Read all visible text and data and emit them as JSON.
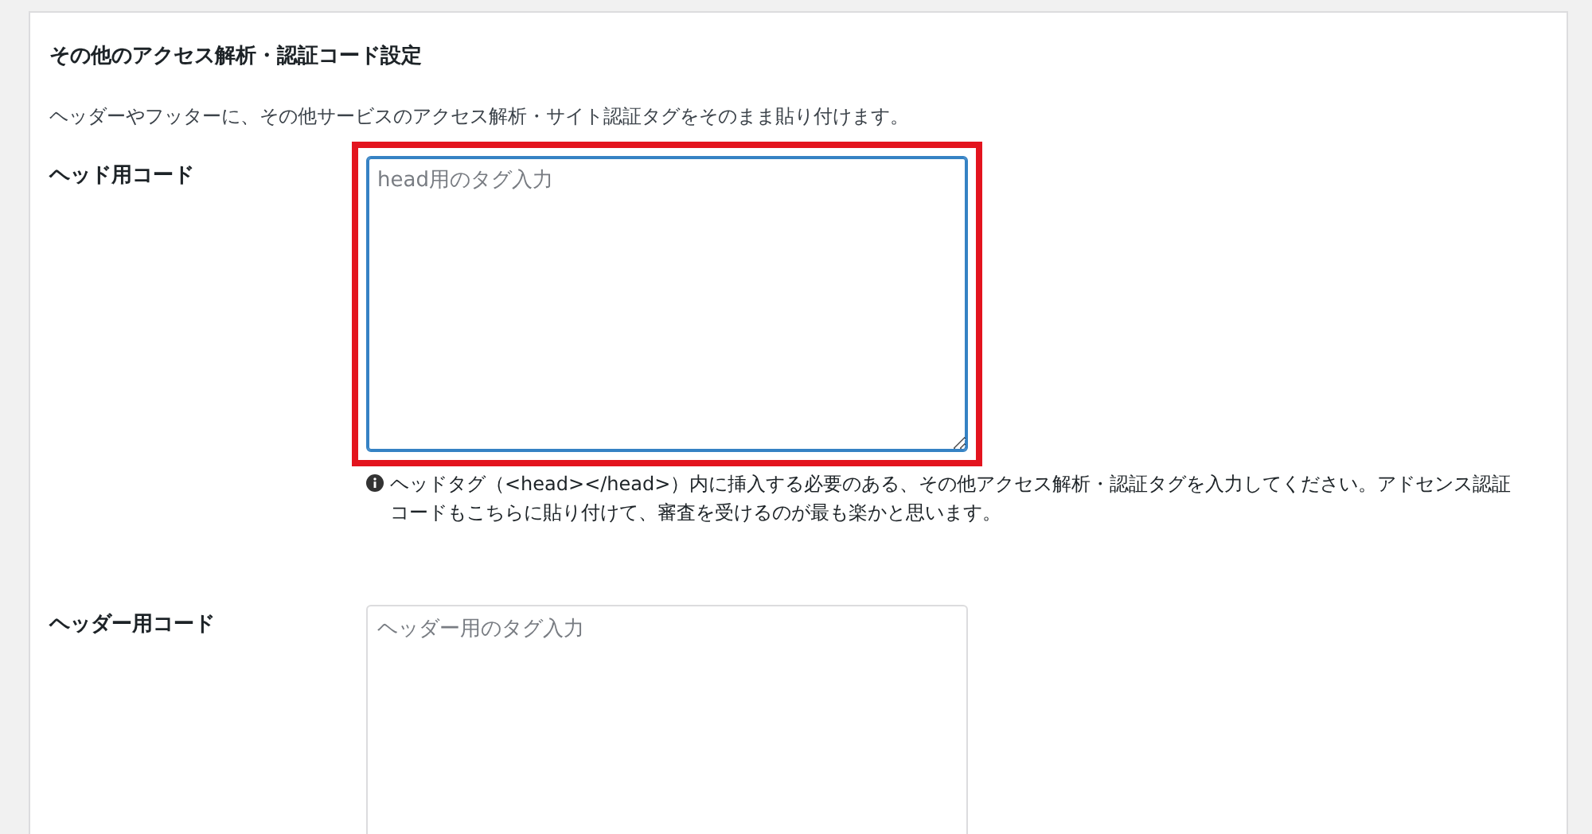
{
  "section": {
    "title": "その他のアクセス解析・認証コード設定",
    "description": "ヘッダーやフッターに、その他サービスのアクセス解析・サイト認証タグをそのまま貼り付けます。"
  },
  "rows": [
    {
      "label": "ヘッド用コード",
      "placeholder": "head用のタグ入力",
      "focused": true,
      "highlighted": true,
      "help": "ヘッドタグ（<head></head>）内に挿入する必要のある、その他アクセス解析・認証タグを入力してください。アドセンス認証コードもこちらに貼り付けて、審査を受けるのが最も楽かと思います。"
    },
    {
      "label": "ヘッダー用コード",
      "placeholder": "ヘッダー用のタグ入力",
      "focused": false,
      "highlighted": false
    }
  ]
}
